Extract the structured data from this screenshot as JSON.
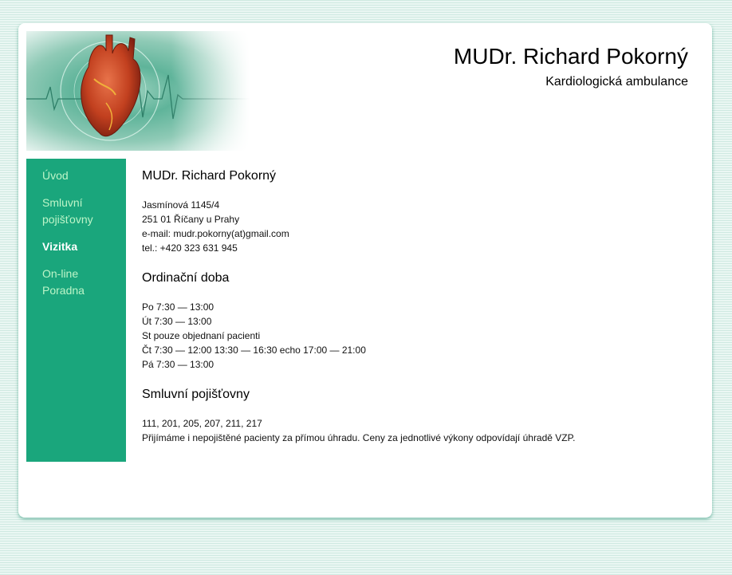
{
  "header": {
    "title": "MUDr. Richard Pokorný",
    "subtitle": "Kardiologická ambulance",
    "image_icon": "heart-ecg-illustration"
  },
  "sidebar": {
    "items": [
      {
        "label": "Úvod",
        "active": false
      },
      {
        "label": "Smluvní pojišťovny",
        "active": false
      },
      {
        "label": "Vizitka",
        "active": true
      },
      {
        "label": "On-line Poradna",
        "active": false
      }
    ]
  },
  "content": {
    "heading_name": "MUDr. Richard Pokorný",
    "address": [
      "Jasmínová 1145/4",
      "251 01 Říčany u Prahy",
      "e-mail: mudr.pokorny(at)gmail.com",
      "tel.: +420 323 631 945"
    ],
    "heading_hours": "Ordinační doba",
    "hours": [
      "Po 7:30 — 13:00",
      "Út 7:30 — 13:00",
      "St pouze objednaní pacienti",
      "Čt 7:30 — 12:00 13:30 — 16:30 echo 17:00 — 21:00",
      "Pá 7:30 — 13:00"
    ],
    "heading_insurance": "Smluvní pojišťovny",
    "insurance": [
      "111, 201, 205, 207, 211, 217",
      "Přijímáme i nepojištěné pacienty za přímou úhradu. Ceny za jednotlivé výkony odpovídají úhradě VZP."
    ]
  },
  "colors": {
    "sidebar": "#1aa67c",
    "nav_link": "#bdf5c8",
    "nav_active": "#ffffff"
  }
}
